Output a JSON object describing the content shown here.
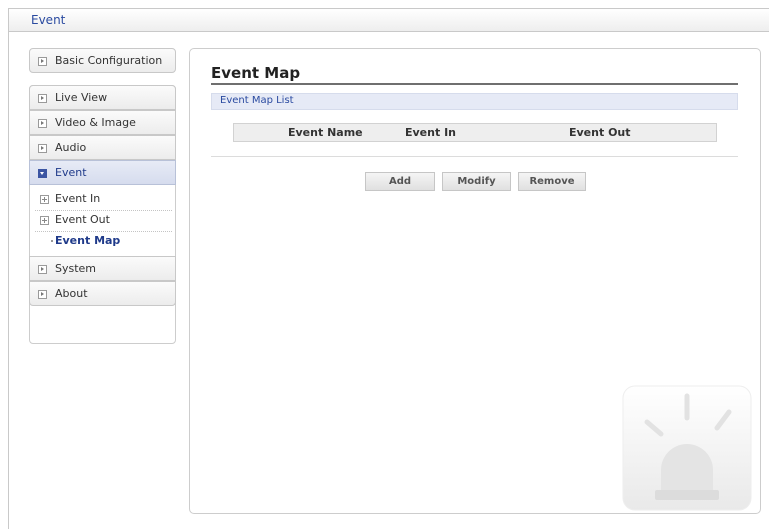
{
  "header": {
    "title": "Event"
  },
  "sidebar": {
    "items": [
      {
        "label": "Basic Configuration"
      },
      {
        "label": "Live View"
      },
      {
        "label": "Video & Image"
      },
      {
        "label": "Audio"
      },
      {
        "label": "Event"
      },
      {
        "label": "System"
      },
      {
        "label": "About"
      }
    ],
    "event_subitems": [
      {
        "label": "Event In"
      },
      {
        "label": "Event Out"
      },
      {
        "label": "Event Map"
      }
    ]
  },
  "main": {
    "title": "Event Map",
    "section_label": "Event Map List",
    "table": {
      "columns": [
        "Event Name",
        "Event In",
        "Event Out"
      ]
    },
    "buttons": {
      "add": "Add",
      "modify": "Modify",
      "remove": "Remove"
    }
  },
  "colors": {
    "accent": "#2a4aa0",
    "active_bg": "#dde3f2",
    "section_bg": "#e6eaf6"
  },
  "icons": {
    "nav_bullet": "box-arrow-icon",
    "expand": "plus-box-icon",
    "watermark": "alarm-light-icon"
  }
}
